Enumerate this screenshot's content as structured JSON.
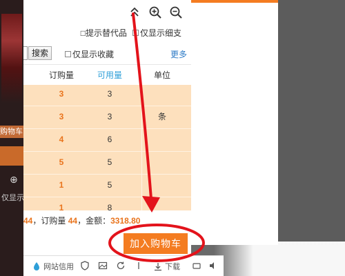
{
  "background": {
    "left_label": "购物车",
    "left_text": "仅显示",
    "accent_color": "#f47c21"
  },
  "toolbar": {
    "icons": [
      "collapse-up-icon",
      "zoom-in-icon",
      "zoom-out-icon"
    ]
  },
  "options": {
    "show_substitutes": "□提示替代品",
    "show_detail_only": "仅显示细支",
    "favorites_only": "仅显示收藏",
    "search_button": "搜索",
    "more_link": "更多"
  },
  "table": {
    "headers": {
      "order_qty": "订购量",
      "available": "可用量",
      "unit": "单位"
    },
    "rows": [
      {
        "order": "3",
        "available": "3",
        "unit": ""
      },
      {
        "order": "3",
        "available": "3",
        "unit": "条"
      },
      {
        "order": "4",
        "available": "6",
        "unit": ""
      },
      {
        "order": "5",
        "available": "5",
        "unit": ""
      },
      {
        "order": "1",
        "available": "5",
        "unit": ""
      },
      {
        "order": "1",
        "available": "8",
        "unit": ""
      }
    ]
  },
  "summary": {
    "count": "44",
    "order_label": "，订购量",
    "order_value": "44",
    "amount_label": "，金额：",
    "amount_value": "3318.80"
  },
  "cart_button": "加入购物车",
  "taskbar": {
    "site_trust": "网站信用",
    "downloads": "下载"
  }
}
